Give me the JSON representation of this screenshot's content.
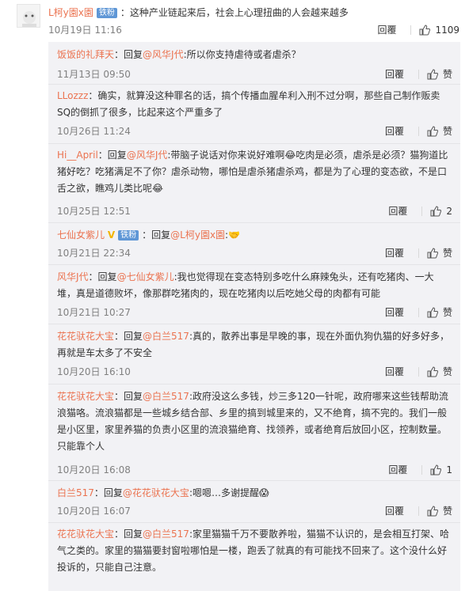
{
  "main_comment": {
    "username": "L柯y園x園",
    "badge": "铁粉",
    "text": "：这种产业链起来后，社会上心理扭曲的人会越来越多",
    "date": "10月19日 11:16",
    "reply_label": "回覆",
    "like_count": "1109"
  },
  "replies": [
    {
      "username": "饭饭的礼拜天",
      "prefix": "：回复",
      "at": "@风华J代",
      "text": ":所以你支持虐待或者虐杀？",
      "date": "11月13日 09:50",
      "reply_label": "回覆",
      "like": "赞"
    },
    {
      "username": "LLozzz",
      "prefix": "：",
      "at": "",
      "text": "确实，就算没这种罪名的话，搞个传播血腥牟利入刑不过分啊，那些自己制作贩卖SQ的倒抓了很多，比起来这个严重多了",
      "date": "10月26日 11:24",
      "reply_label": "回覆",
      "like": "赞"
    },
    {
      "username": "Hi__April",
      "prefix": "：回复",
      "at": "@风华J代",
      "text": ":带脑子说话对你来说好难啊😂吃肉是必须，虐杀是必须？猫狗道比猪好吃？吃猪满足不了你？虐杀动物，哪怕是虐杀猪虐杀鸡，都是为了心理的变态欲，不是口舌之欲，瞧鸡儿类比呢😂",
      "date": "10月25日 12:51",
      "reply_label": "回覆",
      "like": "2"
    },
    {
      "username": "七仙女紫儿",
      "badge": "铁粉",
      "prefix": "：回复",
      "at": "@L柯y園x園",
      "text": ":🤝",
      "date": "10月21日 22:34",
      "reply_label": "回覆",
      "like": "赞"
    },
    {
      "username": "风华J代",
      "prefix": "：回复",
      "at": "@七仙女紫儿",
      "text": ":我也觉得现在变态特别多吃什么麻辣兔头，还有吃猪肉、一大堆，真是道德败坏，像那群吃猪肉的，现在吃猪肉以后吃她父母的肉都有可能",
      "date": "10月21日 10:27",
      "reply_label": "回覆",
      "like": "赞"
    },
    {
      "username": "花花驮花大宝",
      "prefix": "：回复",
      "at": "@白兰517",
      "text": ":真的，散养出事是早晚的事，现在外面仇狗仇猫的好多好多，再就是车太多了不安全",
      "date": "10月20日 16:10",
      "reply_label": "回覆",
      "like": "赞"
    },
    {
      "username": "花花驮花大宝",
      "prefix": "：回复",
      "at": "@白兰517",
      "text": ":政府没这么多钱，炒三多120一针呢，政府哪来这些钱帮助流浪猫咯。流浪猫都是一些城乡结合部、乡里的搞到城里来的，又不绝育，搞不完的。我们一般是小区里，家里养猫的负责小区里的流浪猫绝育、找领养，或者绝育后放回小区，控制数量。只能靠个人",
      "date": "10月20日 16:08",
      "reply_label": "回覆",
      "like": "1"
    },
    {
      "username": "白兰517",
      "prefix": "：回复",
      "at": "@花花驮花大宝",
      "text": ":嗯嗯…多谢提醒😱",
      "date": "10月20日 16:07",
      "reply_label": "回覆",
      "like": "赞"
    },
    {
      "username": "花花驮花大宝",
      "prefix": "：回复",
      "at": "@白兰517",
      "text": ":家里猫猫千万不要散养啦，猫猫不认识的，是会相互打架、哈气之类的。家里的猫猫要封窗啦哪怕是一楼，跑丢了就真的有可能找不回来了。这个没什么好投诉的，只能自己注意。",
      "date": "",
      "reply_label": "",
      "like": ""
    }
  ]
}
